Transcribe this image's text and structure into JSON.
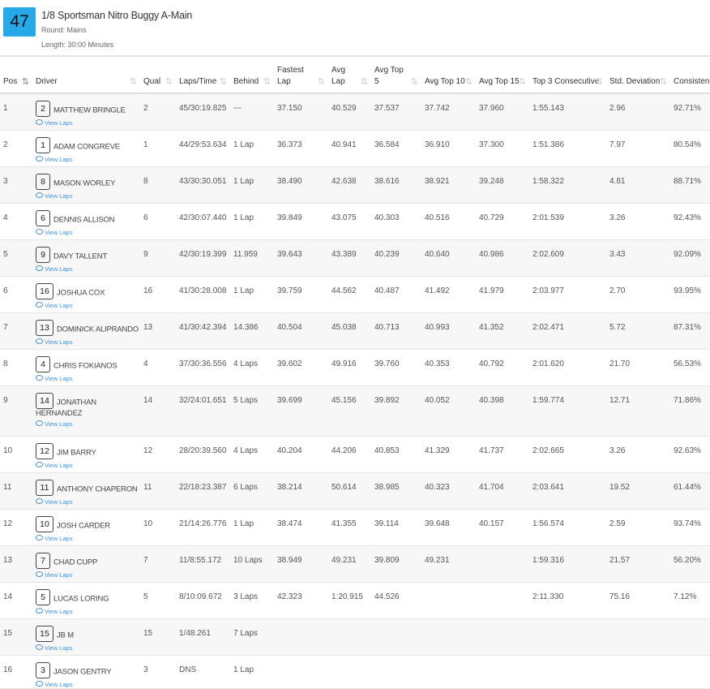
{
  "race": {
    "number": "47",
    "title": "1/8 Sportsman Nitro Buggy A-Main",
    "round": "Round: Mains",
    "length": "Length: 30:00 Minutes"
  },
  "columns": [
    "Pos",
    "Driver",
    "Qual",
    "Laps/Time",
    "Behind",
    "Fastest Lap",
    "Avg Lap",
    "Avg Top 5",
    "Avg Top 10",
    "Avg Top 15",
    "Top 3 Consecutive",
    "Std. Deviation",
    "Consistency"
  ],
  "view_laps_label": "View Laps",
  "rows": [
    {
      "pos": "1",
      "car": "2",
      "driver": "MATTHEW BRINGLE",
      "qual": "2",
      "laps": "45/30:19.825",
      "behind": "---",
      "fastest": "37.150",
      "avg": "40.529",
      "top5": "37.537",
      "top10": "37.742",
      "top15": "37.960",
      "top3c": "1:55.143",
      "std": "2.96",
      "cons": "92.71%"
    },
    {
      "pos": "2",
      "car": "1",
      "driver": "ADAM CONGREVE",
      "qual": "1",
      "laps": "44/29:53.634",
      "behind": "1 Lap",
      "fastest": "36.373",
      "avg": "40.941",
      "top5": "36.584",
      "top10": "36.910",
      "top15": "37.300",
      "top3c": "1:51.386",
      "std": "7.97",
      "cons": "80.54%"
    },
    {
      "pos": "3",
      "car": "8",
      "driver": "MASON WORLEY",
      "qual": "8",
      "laps": "43/30:30.051",
      "behind": "1 Lap",
      "fastest": "38.490",
      "avg": "42.638",
      "top5": "38.616",
      "top10": "38.921",
      "top15": "39.248",
      "top3c": "1:58.322",
      "std": "4.81",
      "cons": "88.71%"
    },
    {
      "pos": "4",
      "car": "6",
      "driver": "DENNIS ALLISON",
      "qual": "6",
      "laps": "42/30:07.440",
      "behind": "1 Lap",
      "fastest": "39.849",
      "avg": "43.075",
      "top5": "40.303",
      "top10": "40.516",
      "top15": "40.729",
      "top3c": "2:01.539",
      "std": "3.26",
      "cons": "92.43%"
    },
    {
      "pos": "5",
      "car": "9",
      "driver": "DAVY TALLENT",
      "qual": "9",
      "laps": "42/30:19.399",
      "behind": "11.959",
      "fastest": "39.643",
      "avg": "43.389",
      "top5": "40.239",
      "top10": "40.640",
      "top15": "40.986",
      "top3c": "2:02.609",
      "std": "3.43",
      "cons": "92.09%"
    },
    {
      "pos": "6",
      "car": "16",
      "driver": "JOSHUA COX",
      "qual": "16",
      "laps": "41/30:28.008",
      "behind": "1 Lap",
      "fastest": "39.759",
      "avg": "44.562",
      "top5": "40.487",
      "top10": "41.492",
      "top15": "41.979",
      "top3c": "2:03.977",
      "std": "2.70",
      "cons": "93.95%"
    },
    {
      "pos": "7",
      "car": "13",
      "driver": "DOMINICK ALIPRANDO",
      "qual": "13",
      "laps": "41/30:42.394",
      "behind": "14.386",
      "fastest": "40.504",
      "avg": "45.038",
      "top5": "40.713",
      "top10": "40.993",
      "top15": "41.352",
      "top3c": "2:02.471",
      "std": "5.72",
      "cons": "87.31%"
    },
    {
      "pos": "8",
      "car": "4",
      "driver": "CHRIS FOKIANOS",
      "qual": "4",
      "laps": "37/30:36.556",
      "behind": "4 Laps",
      "fastest": "39.602",
      "avg": "49.916",
      "top5": "39.760",
      "top10": "40.353",
      "top15": "40.792",
      "top3c": "2:01.620",
      "std": "21.70",
      "cons": "56.53%"
    },
    {
      "pos": "9",
      "car": "14",
      "driver": "JONATHAN HERNANDEZ",
      "qual": "14",
      "laps": "32/24:01.651",
      "behind": "5 Laps",
      "fastest": "39.699",
      "avg": "45.156",
      "top5": "39.892",
      "top10": "40.052",
      "top15": "40.398",
      "top3c": "1:59.774",
      "std": "12.71",
      "cons": "71.86%"
    },
    {
      "pos": "10",
      "car": "12",
      "driver": "JIM BARRY",
      "qual": "12",
      "laps": "28/20:39.560",
      "behind": "4 Laps",
      "fastest": "40.204",
      "avg": "44.206",
      "top5": "40.853",
      "top10": "41.329",
      "top15": "41.737",
      "top3c": "2:02.665",
      "std": "3.26",
      "cons": "92.63%"
    },
    {
      "pos": "11",
      "car": "11",
      "driver": "ANTHONY CHAPERON",
      "qual": "11",
      "laps": "22/18:23.387",
      "behind": "6 Laps",
      "fastest": "38.214",
      "avg": "50.614",
      "top5": "38.985",
      "top10": "40.323",
      "top15": "41.704",
      "top3c": "2:03.641",
      "std": "19.52",
      "cons": "61.44%"
    },
    {
      "pos": "12",
      "car": "10",
      "driver": "JOSH CARDER",
      "qual": "10",
      "laps": "21/14:26.776",
      "behind": "1 Lap",
      "fastest": "38.474",
      "avg": "41.355",
      "top5": "39.114",
      "top10": "39.648",
      "top15": "40.157",
      "top3c": "1:56.574",
      "std": "2.59",
      "cons": "93.74%"
    },
    {
      "pos": "13",
      "car": "7",
      "driver": "CHAD CUPP",
      "qual": "7",
      "laps": "11/8:55.172",
      "behind": "10 Laps",
      "fastest": "38.949",
      "avg": "49.231",
      "top5": "39.809",
      "top10": "49.231",
      "top15": "",
      "top3c": "1:59.316",
      "std": "21.57",
      "cons": "56.20%"
    },
    {
      "pos": "14",
      "car": "5",
      "driver": "LUCAS LORING",
      "qual": "5",
      "laps": "8/10:09.672",
      "behind": "3 Laps",
      "fastest": "42.323",
      "avg": "1:20.915",
      "top5": "44.526",
      "top10": "",
      "top15": "",
      "top3c": "2:11.330",
      "std": "75.16",
      "cons": "7.12%"
    },
    {
      "pos": "15",
      "car": "15",
      "driver": "JB M",
      "qual": "15",
      "laps": "1/48.261",
      "behind": "7 Laps",
      "fastest": "",
      "avg": "",
      "top5": "",
      "top10": "",
      "top15": "",
      "top3c": "",
      "std": "",
      "cons": ""
    },
    {
      "pos": "16",
      "car": "3",
      "driver": "JASON GENTRY",
      "qual": "3",
      "laps": "DNS",
      "behind": "1 Lap",
      "fastest": "",
      "avg": "",
      "top5": "",
      "top10": "",
      "top15": "",
      "top3c": "",
      "std": "",
      "cons": ""
    }
  ]
}
